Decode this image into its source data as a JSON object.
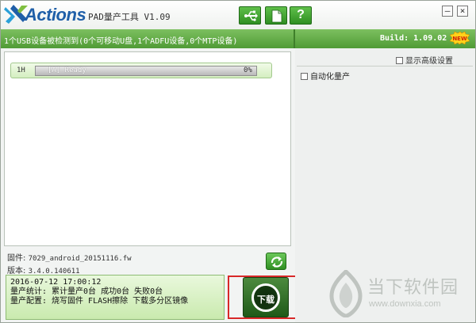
{
  "titlebar": {
    "logo_text": "Actions",
    "app_title": "PAD量产工具 V1.09",
    "buttons": [
      {
        "name": "usb-icon"
      },
      {
        "name": "document-icon"
      },
      {
        "name": "help-icon",
        "glyph": "?"
      }
    ],
    "window_controls": {
      "minimize": "–",
      "close": "×"
    }
  },
  "statusbar": {
    "device_summary": "1个USB设备被检测到(0个可移动U盘,1个ADFU设备,0个MTP设备)",
    "build": "Build: 1.09.02",
    "new_badge": "NEW"
  },
  "devices": [
    {
      "id": "1H",
      "state": "[A] Ready",
      "progress_label": "0%",
      "progress": 0
    }
  ],
  "firmware": {
    "file_label": "固件:",
    "file_value": "7029_android_20151116.fw",
    "version_label": "版本:",
    "version_value": "3.4.0.140611"
  },
  "log": {
    "timestamp": "2016-07-12 17:00:12",
    "stats": "量产统计: 累计量产0台 成功0台 失败0台",
    "config": "量产配置: 烧写固件 FLASH擦除 下载多分区镜像"
  },
  "download_button": {
    "label": "下载"
  },
  "right_panel": {
    "show_advanced_label": "显示高级设置",
    "auto_produce_label": "自动化量产"
  },
  "watermark": {
    "name": "当下软件园",
    "url": "www.downxia.com"
  },
  "colors": {
    "accent_green": "#4f9b35",
    "logo_blue": "#1f5fa8",
    "highlight_red": "#d82828"
  }
}
